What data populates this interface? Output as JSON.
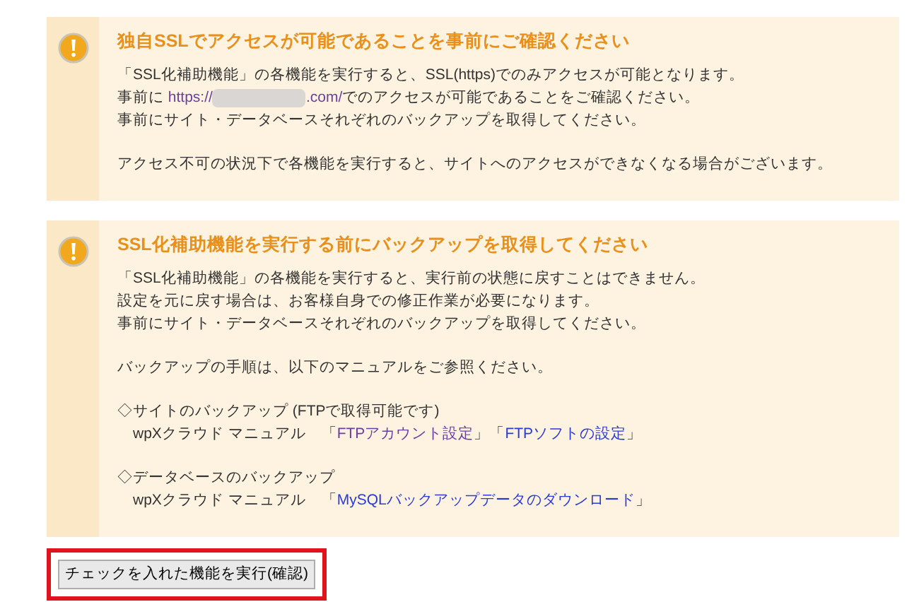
{
  "notices": [
    {
      "title": "独自SSLでアクセスが可能であることを事前にご確認ください",
      "paragraphs": [
        [
          {
            "indent": false,
            "segments": [
              {
                "kind": "text",
                "text": "「SSL化補助機能」の各機能を実行すると、SSL(https)でのみアクセスが可能となります。"
              }
            ]
          },
          {
            "indent": false,
            "segments": [
              {
                "kind": "text",
                "text": "事前に "
              },
              {
                "kind": "link",
                "visited": true,
                "text": "https://"
              },
              {
                "kind": "redacted"
              },
              {
                "kind": "link",
                "visited": true,
                "text": ".com/"
              },
              {
                "kind": "text",
                "text": "でのアクセスが可能であることをご確認ください。"
              }
            ]
          },
          {
            "indent": false,
            "segments": [
              {
                "kind": "text",
                "text": "事前にサイト・データベースそれぞれのバックアップを取得してください。"
              }
            ]
          }
        ],
        [
          {
            "indent": false,
            "segments": [
              {
                "kind": "text",
                "text": "アクセス不可の状況下で各機能を実行すると、サイトへのアクセスができなくなる場合がございます。"
              }
            ]
          }
        ]
      ]
    },
    {
      "title": "SSL化補助機能を実行する前にバックアップを取得してください",
      "paragraphs": [
        [
          {
            "indent": false,
            "segments": [
              {
                "kind": "text",
                "text": "「SSL化補助機能」の各機能を実行すると、実行前の状態に戻すことはできません。"
              }
            ]
          },
          {
            "indent": false,
            "segments": [
              {
                "kind": "text",
                "text": "設定を元に戻す場合は、お客様自身での修正作業が必要になります。"
              }
            ]
          },
          {
            "indent": false,
            "segments": [
              {
                "kind": "text",
                "text": "事前にサイト・データベースそれぞれのバックアップを取得してください。"
              }
            ]
          }
        ],
        [
          {
            "indent": false,
            "segments": [
              {
                "kind": "text",
                "text": "バックアップの手順は、以下のマニュアルをご参照ください。"
              }
            ]
          }
        ],
        [
          {
            "indent": false,
            "segments": [
              {
                "kind": "text",
                "text": "◇サイトのバックアップ (FTPで取得可能です)"
              }
            ]
          },
          {
            "indent": true,
            "segments": [
              {
                "kind": "text",
                "text": "wpXクラウド マニュアル　「"
              },
              {
                "kind": "link",
                "visited": true,
                "text": "FTPアカウント設定"
              },
              {
                "kind": "text",
                "text": "」「"
              },
              {
                "kind": "link",
                "visited": false,
                "text": "FTPソフトの設定"
              },
              {
                "kind": "text",
                "text": "」"
              }
            ]
          }
        ],
        [
          {
            "indent": false,
            "segments": [
              {
                "kind": "text",
                "text": "◇データベースのバックアップ"
              }
            ]
          },
          {
            "indent": true,
            "segments": [
              {
                "kind": "text",
                "text": "wpXクラウド マニュアル　「"
              },
              {
                "kind": "link",
                "visited": false,
                "text": "MySQLバックアップデータのダウンロード"
              },
              {
                "kind": "text",
                "text": "」"
              }
            ]
          }
        ]
      ]
    }
  ],
  "action_button": {
    "label": "チェックを入れた機能を実行(確認)",
    "highlighted": true
  }
}
